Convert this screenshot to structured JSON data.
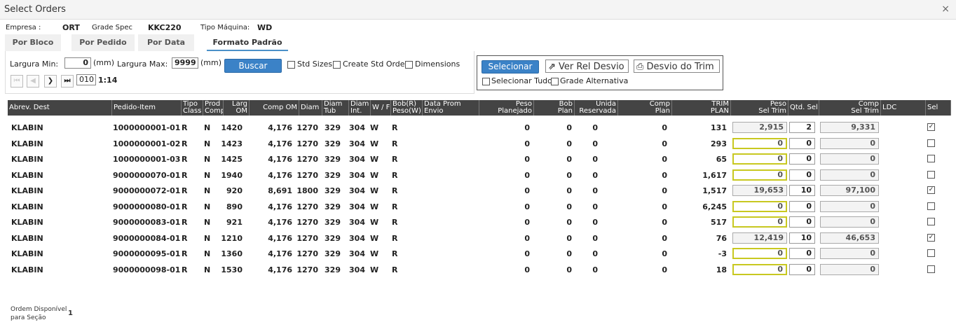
{
  "window": {
    "title": "Select Orders",
    "close": "×"
  },
  "info": {
    "empresa_label": "Empresa :",
    "empresa": "ORT",
    "grade_label": "Grade Spec",
    "grade": "KKC220",
    "maquina_label": "Tipo Máquina:",
    "maquina": "WD"
  },
  "tabs": [
    {
      "label": "Por Bloco"
    },
    {
      "label": "Por Pedido"
    },
    {
      "label": "Por Data"
    },
    {
      "label": "Formato Padrão",
      "active": true
    }
  ],
  "filters": {
    "largura_min_label": "Largura Min:",
    "largura_min": "0",
    "mm1": "(mm)",
    "largura_max_label": "Largura Max:",
    "largura_max": "9999",
    "mm2": "(mm)",
    "buscar": "Buscar",
    "std_sizes": "Std Sizes",
    "create_std_order": "Create Std Order",
    "dimensions": "Dimensions",
    "page": "010",
    "ratio": "1:14"
  },
  "actions": {
    "selecionar": "Selecionar",
    "ver_rel_desvio": "Ver Rel Desvio",
    "desvio_trim": "Desvio do Trim",
    "selecionar_tudo": "Selecionar Tudo",
    "grade_alternativa": "Grade Alternativa"
  },
  "columns": [
    {
      "l1": "Abrev. Dest",
      "l2": ""
    },
    {
      "l1": "Pedido-Item",
      "l2": ""
    },
    {
      "l1": "Tipo",
      "l2": "Class"
    },
    {
      "l1": "Prod",
      "l2": "Comp"
    },
    {
      "l1": "Larg",
      "l2": "OM"
    },
    {
      "l1": "Comp OM",
      "l2": ""
    },
    {
      "l1": "Diam",
      "l2": ""
    },
    {
      "l1": "Diam",
      "l2": "Tub"
    },
    {
      "l1": "Diam",
      "l2": "Int."
    },
    {
      "l1": "W / F",
      "l2": ""
    },
    {
      "l1": "Bob(R)",
      "l2": "Peso(W)"
    },
    {
      "l1": "Data Prom",
      "l2": "Envio"
    },
    {
      "l1": "Peso",
      "l2": "Planejado"
    },
    {
      "l1": "Bob",
      "l2": "Plan"
    },
    {
      "l1": "Unida",
      "l2": "Reservada"
    },
    {
      "l1": "Comp",
      "l2": "Plan"
    },
    {
      "l1": "TRIM",
      "l2": "PLAN"
    },
    {
      "l1": "Peso",
      "l2": "Sel Trim"
    },
    {
      "l1": "Qtd. Sel",
      "l2": ""
    },
    {
      "l1": "Comp",
      "l2": "Sel Trim"
    },
    {
      "l1": "LDC",
      "l2": ""
    },
    {
      "l1": "Sel",
      "l2": ""
    }
  ],
  "rows": [
    {
      "dest": "KLABIN",
      "pedido": "1000000001-01",
      "tipo": "R",
      "prod": "N",
      "larg": "1420",
      "comp": "4,176",
      "diam": "1270",
      "tub": "329",
      "int": "304",
      "wf": "W",
      "bob": "R",
      "peso": "0",
      "bobplan": "0",
      "unida": "0",
      "compplan": "0",
      "trim": "131",
      "pesosel": "2,915",
      "qtd": "2",
      "compsel": "9,331",
      "sel": true
    },
    {
      "dest": "KLABIN",
      "pedido": "1000000001-02",
      "tipo": "R",
      "prod": "N",
      "larg": "1423",
      "comp": "4,176",
      "diam": "1270",
      "tub": "329",
      "int": "304",
      "wf": "W",
      "bob": "R",
      "peso": "0",
      "bobplan": "0",
      "unida": "0",
      "compplan": "0",
      "trim": "293",
      "pesosel": "0",
      "qtd": "0",
      "compsel": "0",
      "sel": false
    },
    {
      "dest": "KLABIN",
      "pedido": "1000000001-03",
      "tipo": "R",
      "prod": "N",
      "larg": "1425",
      "comp": "4,176",
      "diam": "1270",
      "tub": "329",
      "int": "304",
      "wf": "W",
      "bob": "R",
      "peso": "0",
      "bobplan": "0",
      "unida": "0",
      "compplan": "0",
      "trim": "65",
      "pesosel": "0",
      "qtd": "0",
      "compsel": "0",
      "sel": false
    },
    {
      "dest": "KLABIN",
      "pedido": "9000000070-01",
      "tipo": "R",
      "prod": "N",
      "larg": "1940",
      "comp": "4,176",
      "diam": "1270",
      "tub": "329",
      "int": "304",
      "wf": "W",
      "bob": "R",
      "peso": "0",
      "bobplan": "0",
      "unida": "0",
      "compplan": "0",
      "trim": "1,617",
      "pesosel": "0",
      "qtd": "0",
      "compsel": "0",
      "sel": false
    },
    {
      "dest": "KLABIN",
      "pedido": "9000000072-01",
      "tipo": "R",
      "prod": "N",
      "larg": "920",
      "comp": "8,691",
      "diam": "1800",
      "tub": "329",
      "int": "304",
      "wf": "W",
      "bob": "R",
      "peso": "0",
      "bobplan": "0",
      "unida": "0",
      "compplan": "0",
      "trim": "1,517",
      "pesosel": "19,653",
      "qtd": "10",
      "compsel": "97,100",
      "sel": true
    },
    {
      "dest": "KLABIN",
      "pedido": "9000000080-01",
      "tipo": "R",
      "prod": "N",
      "larg": "890",
      "comp": "4,176",
      "diam": "1270",
      "tub": "329",
      "int": "304",
      "wf": "W",
      "bob": "R",
      "peso": "0",
      "bobplan": "0",
      "unida": "0",
      "compplan": "0",
      "trim": "6,245",
      "pesosel": "0",
      "qtd": "0",
      "compsel": "0",
      "sel": false
    },
    {
      "dest": "KLABIN",
      "pedido": "9000000083-01",
      "tipo": "R",
      "prod": "N",
      "larg": "921",
      "comp": "4,176",
      "diam": "1270",
      "tub": "329",
      "int": "304",
      "wf": "W",
      "bob": "R",
      "peso": "0",
      "bobplan": "0",
      "unida": "0",
      "compplan": "0",
      "trim": "517",
      "pesosel": "0",
      "qtd": "0",
      "compsel": "0",
      "sel": false
    },
    {
      "dest": "KLABIN",
      "pedido": "9000000084-01",
      "tipo": "R",
      "prod": "N",
      "larg": "1210",
      "comp": "4,176",
      "diam": "1270",
      "tub": "329",
      "int": "304",
      "wf": "W",
      "bob": "R",
      "peso": "0",
      "bobplan": "0",
      "unida": "0",
      "compplan": "0",
      "trim": "76",
      "pesosel": "12,419",
      "qtd": "10",
      "compsel": "46,653",
      "sel": true
    },
    {
      "dest": "KLABIN",
      "pedido": "9000000095-01",
      "tipo": "R",
      "prod": "N",
      "larg": "1360",
      "comp": "4,176",
      "diam": "1270",
      "tub": "329",
      "int": "304",
      "wf": "W",
      "bob": "R",
      "peso": "0",
      "bobplan": "0",
      "unida": "0",
      "compplan": "0",
      "trim": "-3",
      "pesosel": "0",
      "qtd": "0",
      "compsel": "0",
      "sel": false
    },
    {
      "dest": "KLABIN",
      "pedido": "9000000098-01",
      "tipo": "R",
      "prod": "N",
      "larg": "1530",
      "comp": "4,176",
      "diam": "1270",
      "tub": "329",
      "int": "304",
      "wf": "W",
      "bob": "R",
      "peso": "0",
      "bobplan": "0",
      "unida": "0",
      "compplan": "0",
      "trim": "18",
      "pesosel": "0",
      "qtd": "0",
      "compsel": "0",
      "sel": false
    }
  ],
  "footer": {
    "label1": "Ordem Disponível",
    "label2": "para Seção",
    "value": "1"
  }
}
